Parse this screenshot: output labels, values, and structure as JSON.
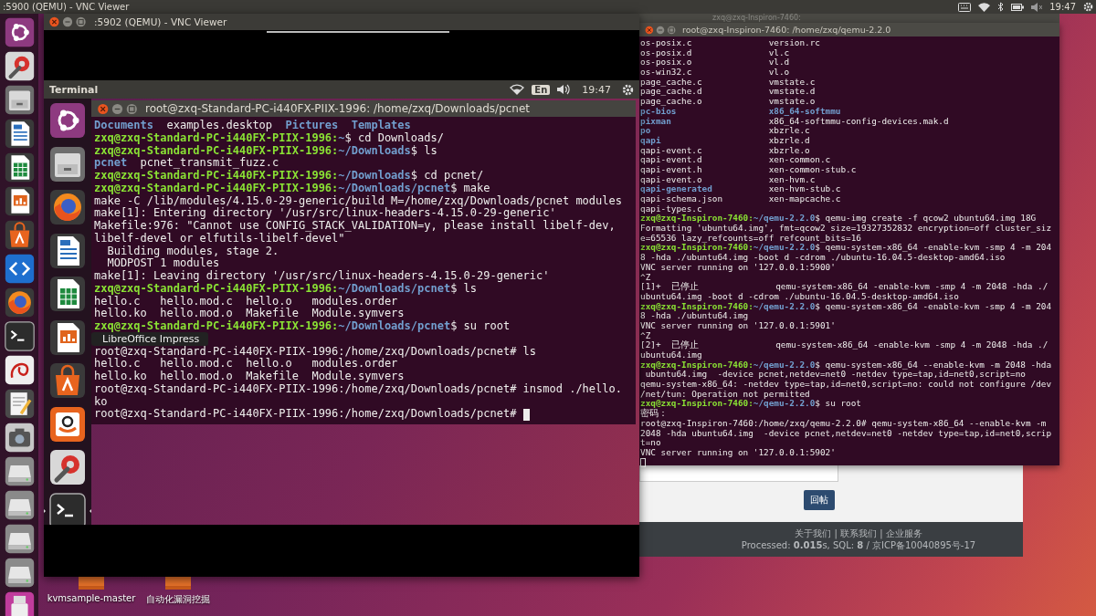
{
  "host_top_bar": {
    "title": ":5900 (QEMU) - VNC Viewer",
    "time": "19:47"
  },
  "host_launcher": {
    "items": [
      {
        "kind": "ubuntu"
      },
      {
        "kind": "tools"
      },
      {
        "kind": "drawer"
      },
      {
        "kind": "writer"
      },
      {
        "kind": "calc"
      },
      {
        "kind": "impress"
      },
      {
        "kind": "software"
      },
      {
        "kind": "code"
      },
      {
        "kind": "firefox"
      },
      {
        "kind": "terminal"
      },
      {
        "kind": "reader"
      },
      {
        "kind": "editor"
      },
      {
        "kind": "camera"
      },
      {
        "kind": "drive"
      },
      {
        "kind": "drive"
      },
      {
        "kind": "drive"
      },
      {
        "kind": "drive"
      },
      {
        "kind": "usb"
      }
    ]
  },
  "background_window": {
    "title": "zxq@zxq-Inspiron-7460:"
  },
  "web_page": {
    "button": "回帖",
    "footer_links": "关于我们 | 联系我们 | 企业服务",
    "footer_info": "Processed: **0.015**s, SQL: **8** / 京ICP备10040895号-17"
  },
  "right_terminal": {
    "title": "root@zxq-Inspiron-7460: /home/zxq/qemu-2.2.0",
    "lines": [
      {
        "kind": "listing",
        "columns": [
          {
            "kind": "plain",
            "text": "os-posix.c"
          },
          {
            "kind": "plain",
            "text": "version.rc"
          }
        ]
      },
      {
        "kind": "listing",
        "columns": [
          {
            "kind": "plain",
            "text": "os-posix.d"
          },
          {
            "kind": "plain",
            "text": "vl.c"
          }
        ]
      },
      {
        "kind": "listing",
        "columns": [
          {
            "kind": "plain",
            "text": "os-posix.o"
          },
          {
            "kind": "plain",
            "text": "vl.d"
          }
        ]
      },
      {
        "kind": "listing",
        "columns": [
          {
            "kind": "plain",
            "text": "os-win32.c"
          },
          {
            "kind": "plain",
            "text": "vl.o"
          }
        ]
      },
      {
        "kind": "listing",
        "columns": [
          {
            "kind": "plain",
            "text": "page_cache.c"
          },
          {
            "kind": "plain",
            "text": "vmstate.c"
          }
        ]
      },
      {
        "kind": "listing",
        "columns": [
          {
            "kind": "plain",
            "text": "page_cache.d"
          },
          {
            "kind": "plain",
            "text": "vmstate.d"
          }
        ]
      },
      {
        "kind": "listing",
        "columns": [
          {
            "kind": "plain",
            "text": "page_cache.o"
          },
          {
            "kind": "plain",
            "text": "vmstate.o"
          }
        ]
      },
      {
        "kind": "listing",
        "columns": [
          {
            "kind": "dir",
            "text": "pc-bios"
          },
          {
            "kind": "dir",
            "text": "x86_64-softmmu"
          }
        ]
      },
      {
        "kind": "listing",
        "columns": [
          {
            "kind": "dir",
            "text": "pixman"
          },
          {
            "kind": "plain",
            "text": "x86_64-softmmu-config-devices.mak.d"
          }
        ]
      },
      {
        "kind": "listing",
        "columns": [
          {
            "kind": "dir",
            "text": "po"
          },
          {
            "kind": "plain",
            "text": "xbzrle.c"
          }
        ]
      },
      {
        "kind": "listing",
        "columns": [
          {
            "kind": "dir",
            "text": "qapi"
          },
          {
            "kind": "plain",
            "text": "xbzrle.d"
          }
        ]
      },
      {
        "kind": "listing",
        "columns": [
          {
            "kind": "plain",
            "text": "qapi-event.c"
          },
          {
            "kind": "plain",
            "text": "xbzrle.o"
          }
        ]
      },
      {
        "kind": "listing",
        "columns": [
          {
            "kind": "plain",
            "text": "qapi-event.d"
          },
          {
            "kind": "plain",
            "text": "xen-common.c"
          }
        ]
      },
      {
        "kind": "listing",
        "columns": [
          {
            "kind": "plain",
            "text": "qapi-event.h"
          },
          {
            "kind": "plain",
            "text": "xen-common-stub.c"
          }
        ]
      },
      {
        "kind": "listing",
        "columns": [
          {
            "kind": "plain",
            "text": "qapi-event.o"
          },
          {
            "kind": "plain",
            "text": "xen-hvm.c"
          }
        ]
      },
      {
        "kind": "listing",
        "columns": [
          {
            "kind": "dir",
            "text": "qapi-generated"
          },
          {
            "kind": "plain",
            "text": "xen-hvm-stub.c"
          }
        ]
      },
      {
        "kind": "listing",
        "columns": [
          {
            "kind": "plain",
            "text": "qapi-schema.json"
          },
          {
            "kind": "plain",
            "text": "xen-mapcache.c"
          }
        ]
      },
      {
        "kind": "listing",
        "columns": [
          {
            "kind": "plain",
            "text": "qapi-types.c"
          }
        ]
      },
      {
        "kind": "text",
        "segments": [
          {
            "kind": "user",
            "text": "zxq@zxq-Inspiron-7460:"
          },
          {
            "kind": "path",
            "text": "~/qemu-2.2.0"
          },
          {
            "kind": "plain",
            "text": "$ qemu-img create -f qcow2 ubuntu64.img 18G"
          }
        ]
      },
      {
        "kind": "text",
        "segments": [
          {
            "kind": "plain",
            "text": "Formatting 'ubuntu64.img', fmt=qcow2 size=19327352832 encryption=off cluster_siz"
          }
        ]
      },
      {
        "kind": "text",
        "segments": [
          {
            "kind": "plain",
            "text": "e=65536 lazy_refcounts=off refcount_bits=16"
          }
        ]
      },
      {
        "kind": "text",
        "segments": [
          {
            "kind": "user",
            "text": "zxq@zxq-Inspiron-7460:"
          },
          {
            "kind": "path",
            "text": "~/qemu-2.2.0"
          },
          {
            "kind": "plain",
            "text": "$ qemu-system-x86_64 -enable-kvm -smp 4 -m 204"
          }
        ]
      },
      {
        "kind": "text",
        "segments": [
          {
            "kind": "plain",
            "text": "8 -hda ./ubuntu64.img -boot d -cdrom ./ubuntu-16.04.5-desktop-amd64.iso"
          }
        ]
      },
      {
        "kind": "text",
        "segments": [
          {
            "kind": "plain",
            "text": "VNC server running on '127.0.0.1:5900'"
          }
        ]
      },
      {
        "kind": "text",
        "segments": [
          {
            "kind": "plain",
            "text": "^Z"
          }
        ]
      },
      {
        "kind": "text",
        "segments": [
          {
            "kind": "plain",
            "text": "[1]+  "
          },
          {
            "kind": "cjk",
            "text": "已停止"
          },
          {
            "kind": "plain",
            "text": "               qemu-system-x86_64 -enable-kvm -smp 4 -m 2048 -hda ./"
          }
        ]
      },
      {
        "kind": "text",
        "segments": [
          {
            "kind": "plain",
            "text": "ubuntu64.img -boot d -cdrom ./ubuntu-16.04.5-desktop-amd64.iso"
          }
        ]
      },
      {
        "kind": "text",
        "segments": [
          {
            "kind": "user",
            "text": "zxq@zxq-Inspiron-7460:"
          },
          {
            "kind": "path",
            "text": "~/qemu-2.2.0"
          },
          {
            "kind": "plain",
            "text": "$ qemu-system-x86_64 -enable-kvm -smp 4 -m 204"
          }
        ]
      },
      {
        "kind": "text",
        "segments": [
          {
            "kind": "plain",
            "text": "8 -hda ./ubuntu64.img"
          }
        ]
      },
      {
        "kind": "text",
        "segments": [
          {
            "kind": "plain",
            "text": "VNC server running on '127.0.0.1:5901'"
          }
        ]
      },
      {
        "kind": "text",
        "segments": [
          {
            "kind": "plain",
            "text": "^Z"
          }
        ]
      },
      {
        "kind": "text",
        "segments": [
          {
            "kind": "plain",
            "text": "[2]+  "
          },
          {
            "kind": "cjk",
            "text": "已停止"
          },
          {
            "kind": "plain",
            "text": "               qemu-system-x86_64 -enable-kvm -smp 4 -m 2048 -hda ./"
          }
        ]
      },
      {
        "kind": "text",
        "segments": [
          {
            "kind": "plain",
            "text": "ubuntu64.img"
          }
        ]
      },
      {
        "kind": "text",
        "segments": [
          {
            "kind": "user",
            "text": "zxq@zxq-Inspiron-7460:"
          },
          {
            "kind": "path",
            "text": "~/qemu-2.2.0"
          },
          {
            "kind": "plain",
            "text": "$ qemu-system-x86_64 --enable-kvm -m 2048 -hda"
          }
        ]
      },
      {
        "kind": "text",
        "segments": [
          {
            "kind": "plain",
            "text": " ubuntu64.img  -device pcnet,netdev=net0 -netdev type=tap,id=net0,script=no"
          }
        ]
      },
      {
        "kind": "text",
        "segments": [
          {
            "kind": "plain",
            "text": "qemu-system-x86_64: -netdev type=tap,id=net0,script=no: could not configure /dev"
          }
        ]
      },
      {
        "kind": "text",
        "segments": [
          {
            "kind": "plain",
            "text": "/net/tun: Operation not permitted"
          }
        ]
      },
      {
        "kind": "text",
        "segments": [
          {
            "kind": "user",
            "text": "zxq@zxq-Inspiron-7460:"
          },
          {
            "kind": "path",
            "text": "~/qemu-2.2.0"
          },
          {
            "kind": "plain",
            "text": "$ su root"
          }
        ]
      },
      {
        "kind": "text",
        "segments": [
          {
            "kind": "cjk",
            "text": "密码："
          }
        ]
      },
      {
        "kind": "text",
        "segments": [
          {
            "kind": "plain",
            "text": "root@zxq-Inspiron-7460:/home/zxq/qemu-2.2.0# qemu-system-x86_64 --enable-kvm -m"
          }
        ]
      },
      {
        "kind": "text",
        "segments": [
          {
            "kind": "plain",
            "text": "2048 -hda ubuntu64.img  -device pcnet,netdev=net0 -netdev type=tap,id=net0,scrip"
          }
        ]
      },
      {
        "kind": "text",
        "segments": [
          {
            "kind": "plain",
            "text": "t=no"
          }
        ]
      },
      {
        "kind": "text",
        "segments": [
          {
            "kind": "plain",
            "text": "VNC server running on '127.0.0.1:5902'"
          }
        ]
      },
      {
        "kind": "text",
        "segments": [
          {
            "kind": "cursor"
          }
        ]
      }
    ]
  },
  "desktop_icons": [
    {
      "label": "kvmsample-master"
    },
    {
      "label": "自动化漏洞挖掘"
    }
  ],
  "vnc_window": {
    "title": ":5902 (QEMU) - VNC Viewer",
    "guest_top_bar": {
      "app": "Terminal",
      "input_method": "En",
      "time": "19:47"
    },
    "guest_launcher": {
      "items": [
        {
          "kind": "ubuntu",
          "running": false
        },
        {
          "kind": "drawer",
          "running": false
        },
        {
          "kind": "firefox",
          "running": false
        },
        {
          "kind": "writer",
          "running": false
        },
        {
          "kind": "calc",
          "running": false
        },
        {
          "kind": "impress",
          "running": false
        },
        {
          "kind": "software",
          "running": false
        },
        {
          "kind": "store",
          "running": false
        },
        {
          "kind": "tools",
          "running": false
        },
        {
          "kind": "terminal",
          "running": true
        }
      ]
    },
    "tooltip": "LibreOffice Impress",
    "terminal": {
      "title": "root@zxq-Standard-PC-i440FX-PIIX-1996: /home/zxq/Downloads/pcnet",
      "lines": [
        {
          "kind": "listing",
          "columns": [
            {
              "kind": "dir",
              "text": "Documents"
            },
            {
              "kind": "plain",
              "text": "examples.desktop"
            },
            {
              "kind": "dir",
              "text": "Pictures"
            },
            {
              "kind": "dir",
              "text": "Templates"
            }
          ]
        },
        {
          "kind": "text",
          "segments": [
            {
              "kind": "user",
              "text": "zxq@zxq-Standard-PC-i440FX-PIIX-1996:"
            },
            {
              "kind": "path",
              "text": "~"
            },
            {
              "kind": "plain",
              "text": "$ cd Downloads/"
            }
          ]
        },
        {
          "kind": "text",
          "segments": [
            {
              "kind": "user",
              "text": "zxq@zxq-Standard-PC-i440FX-PIIX-1996:"
            },
            {
              "kind": "path",
              "text": "~/Downloads"
            },
            {
              "kind": "plain",
              "text": "$ ls"
            }
          ]
        },
        {
          "kind": "listing",
          "columns": [
            {
              "kind": "dir",
              "text": "pcnet"
            },
            {
              "kind": "plain",
              "text": "pcnet_transmit_fuzz.c"
            }
          ]
        },
        {
          "kind": "text",
          "segments": [
            {
              "kind": "user",
              "text": "zxq@zxq-Standard-PC-i440FX-PIIX-1996:"
            },
            {
              "kind": "path",
              "text": "~/Downloads"
            },
            {
              "kind": "plain",
              "text": "$ cd pcnet/"
            }
          ]
        },
        {
          "kind": "text",
          "segments": [
            {
              "kind": "user",
              "text": "zxq@zxq-Standard-PC-i440FX-PIIX-1996:"
            },
            {
              "kind": "path",
              "text": "~/Downloads/pcnet"
            },
            {
              "kind": "plain",
              "text": "$ make"
            }
          ]
        },
        {
          "kind": "text",
          "segments": [
            {
              "kind": "plain",
              "text": "make -C /lib/modules/4.15.0-29-generic/build M=/home/zxq/Downloads/pcnet modules"
            }
          ]
        },
        {
          "kind": "text",
          "segments": [
            {
              "kind": "plain",
              "text": "make[1]: Entering directory '/usr/src/linux-headers-4.15.0-29-generic'"
            }
          ]
        },
        {
          "kind": "text",
          "segments": [
            {
              "kind": "plain",
              "text": "Makefile:976: \"Cannot use CONFIG_STACK_VALIDATION=y, please install libelf-dev,"
            }
          ]
        },
        {
          "kind": "text",
          "segments": [
            {
              "kind": "plain",
              "text": "libelf-devel or elfutils-libelf-devel\""
            }
          ]
        },
        {
          "kind": "text",
          "segments": [
            {
              "kind": "plain",
              "text": "  Building modules, stage 2."
            }
          ]
        },
        {
          "kind": "text",
          "segments": [
            {
              "kind": "plain",
              "text": "  MODPOST 1 modules"
            }
          ]
        },
        {
          "kind": "text",
          "segments": [
            {
              "kind": "plain",
              "text": "make[1]: Leaving directory '/usr/src/linux-headers-4.15.0-29-generic'"
            }
          ]
        },
        {
          "kind": "text",
          "segments": [
            {
              "kind": "user",
              "text": "zxq@zxq-Standard-PC-i440FX-PIIX-1996:"
            },
            {
              "kind": "path",
              "text": "~/Downloads/pcnet"
            },
            {
              "kind": "plain",
              "text": "$ ls"
            }
          ]
        },
        {
          "kind": "text",
          "segments": [
            {
              "kind": "plain",
              "text": "hello.c   hello.mod.c  hello.o   modules.order"
            }
          ]
        },
        {
          "kind": "text",
          "segments": [
            {
              "kind": "plain",
              "text": "hello.ko  hello.mod.o  Makefile  Module.symvers"
            }
          ]
        },
        {
          "kind": "text",
          "segments": [
            {
              "kind": "user",
              "text": "zxq@zxq-Standard-PC-i440FX-PIIX-1996:"
            },
            {
              "kind": "path",
              "text": "~/Downloads/pcnet"
            },
            {
              "kind": "plain",
              "text": "$ su root"
            }
          ]
        },
        {
          "kind": "covered"
        },
        {
          "kind": "text",
          "segments": [
            {
              "kind": "plain",
              "text": "root@zxq-Standard-PC-i440FX-PIIX-1996:/home/zxq/Downloads/pcnet# ls"
            }
          ]
        },
        {
          "kind": "text",
          "segments": [
            {
              "kind": "plain",
              "text": "hello.c   hello.mod.c  hello.o   modules.order"
            }
          ]
        },
        {
          "kind": "text",
          "segments": [
            {
              "kind": "plain",
              "text": "hello.ko  hello.mod.o  Makefile  Module.symvers"
            }
          ]
        },
        {
          "kind": "text",
          "segments": [
            {
              "kind": "plain",
              "text": "root@zxq-Standard-PC-i440FX-PIIX-1996:/home/zxq/Downloads/pcnet# insmod ./hello."
            }
          ]
        },
        {
          "kind": "text",
          "segments": [
            {
              "kind": "plain",
              "text": "ko"
            }
          ]
        },
        {
          "kind": "text",
          "segments": [
            {
              "kind": "plain",
              "text": "root@zxq-Standard-PC-i440FX-PIIX-1996:/home/zxq/Downloads/pcnet#"
            },
            {
              "kind": "cursor"
            }
          ]
        }
      ]
    }
  }
}
